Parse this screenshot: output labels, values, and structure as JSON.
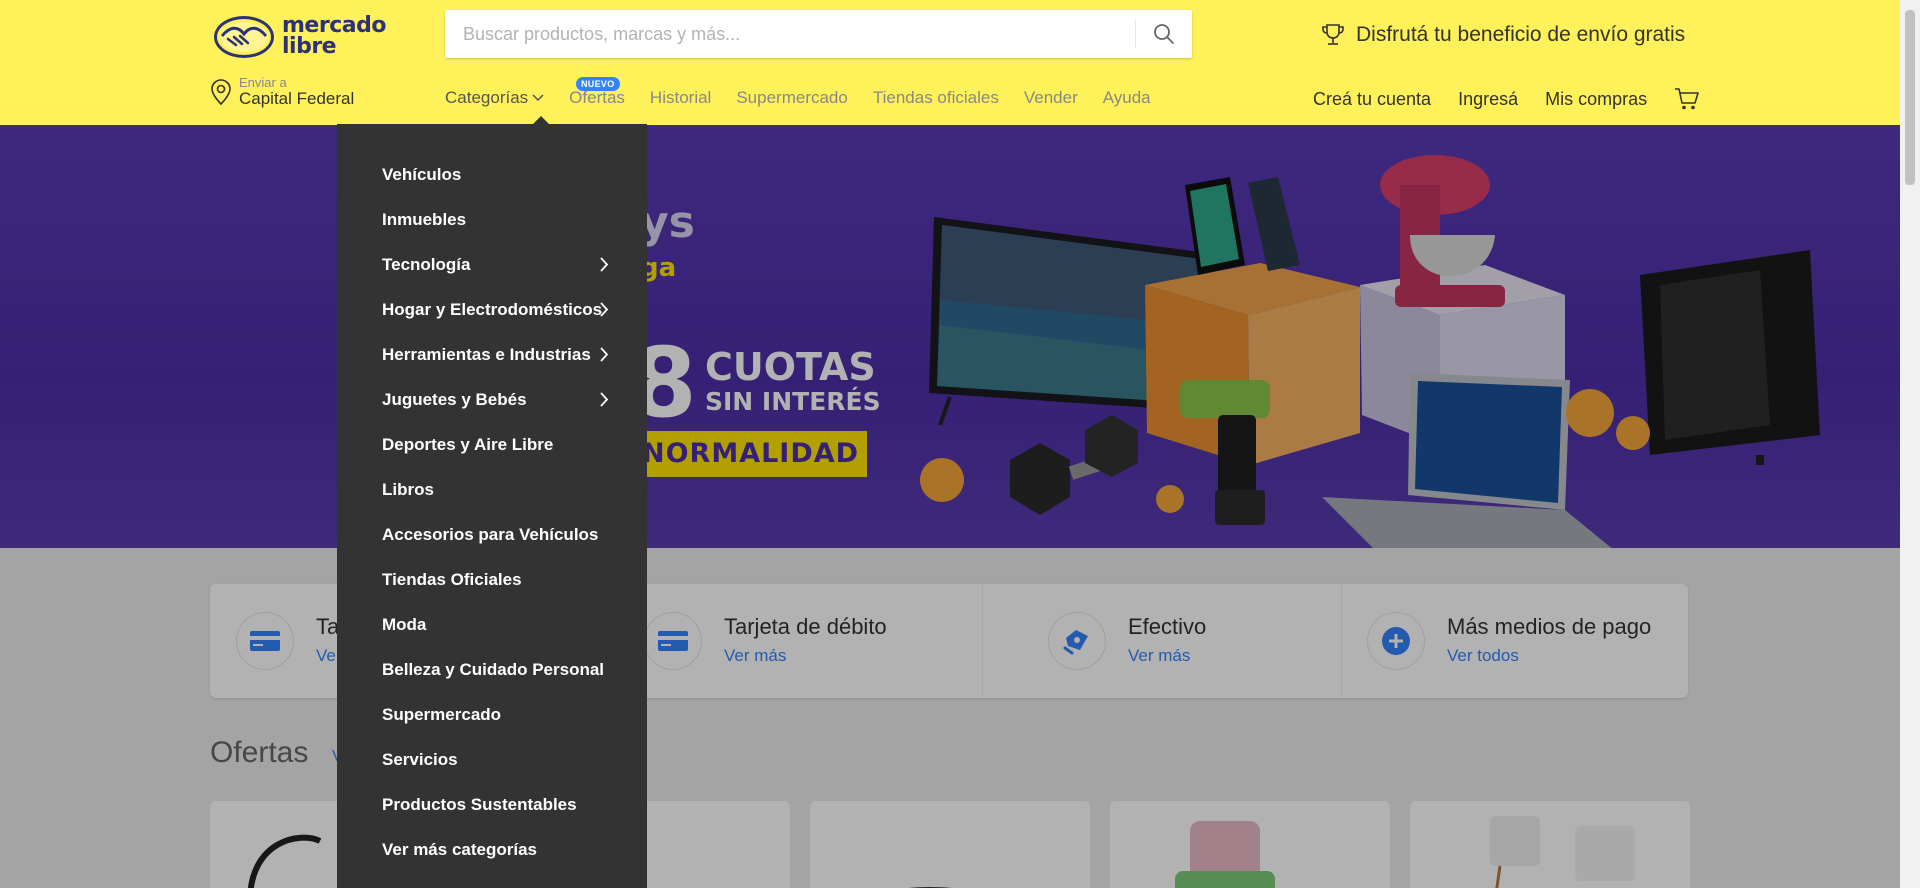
{
  "header": {
    "logo_line1": "mercado",
    "logo_line2": "libre",
    "search_placeholder": "Buscar productos, marcas y más...",
    "promo": "Disfrutá tu beneficio de envío gratis",
    "location_label": "Enviar a",
    "location_value": "Capital Federal",
    "nav": {
      "categorias": "Categorías",
      "ofertas": "Ofertas",
      "ofertas_badge": "NUEVO",
      "historial": "Historial",
      "supermercado": "Supermercado",
      "tiendas": "Tiendas oficiales",
      "vender": "Vender",
      "ayuda": "Ayuda"
    },
    "user_nav": {
      "crea_cuenta": "Creá tu cuenta",
      "ingresa": "Ingresá",
      "mis_compras": "Mis compras"
    }
  },
  "hero": {
    "line1": "ys",
    "line2": "ga",
    "number": "8",
    "cuotas": "CUOTAS",
    "sin_interes": "SIN INTERÉS",
    "normalidad": "NORMALIDAD",
    "slides": 5,
    "active_slide": 2
  },
  "payment": [
    {
      "title": "Ta",
      "link": "Ve",
      "icon": "credit-card-icon"
    },
    {
      "title": "Tarjeta de débito",
      "link": "Ver más",
      "icon": "debit-card-icon"
    },
    {
      "title": "Efectivo",
      "link": "Ver más",
      "icon": "cash-icon"
    },
    {
      "title": "Más medios de pago",
      "link": "Ver todos",
      "icon": "plus-icon"
    }
  ],
  "ofertas": {
    "title": "Ofertas",
    "link": "V"
  },
  "dropdown": {
    "items": [
      {
        "label": "Vehículos",
        "has_sub": false
      },
      {
        "label": "Inmuebles",
        "has_sub": false
      },
      {
        "label": "Tecnología",
        "has_sub": true
      },
      {
        "label": "Hogar y Electrodomésticos",
        "has_sub": true
      },
      {
        "label": "Herramientas e Industrias",
        "has_sub": true
      },
      {
        "label": "Juguetes y Bebés",
        "has_sub": true
      },
      {
        "label": "Deportes y Aire Libre",
        "has_sub": false
      },
      {
        "label": "Libros",
        "has_sub": false
      },
      {
        "label": "Accesorios para Vehículos",
        "has_sub": false
      },
      {
        "label": "Tiendas Oficiales",
        "has_sub": false
      },
      {
        "label": "Moda",
        "has_sub": false
      },
      {
        "label": "Belleza y Cuidado Personal",
        "has_sub": false
      },
      {
        "label": "Supermercado",
        "has_sub": false
      },
      {
        "label": "Servicios",
        "has_sub": false
      },
      {
        "label": "Productos Sustentables",
        "has_sub": false
      },
      {
        "label": "Ver más categorías",
        "has_sub": false
      }
    ]
  },
  "colors": {
    "header_bg": "#fff159",
    "accent": "#3483fa",
    "brand_navy": "#2d3277",
    "hero_bg": "#4d2fa8",
    "dropdown_bg": "#333333"
  }
}
